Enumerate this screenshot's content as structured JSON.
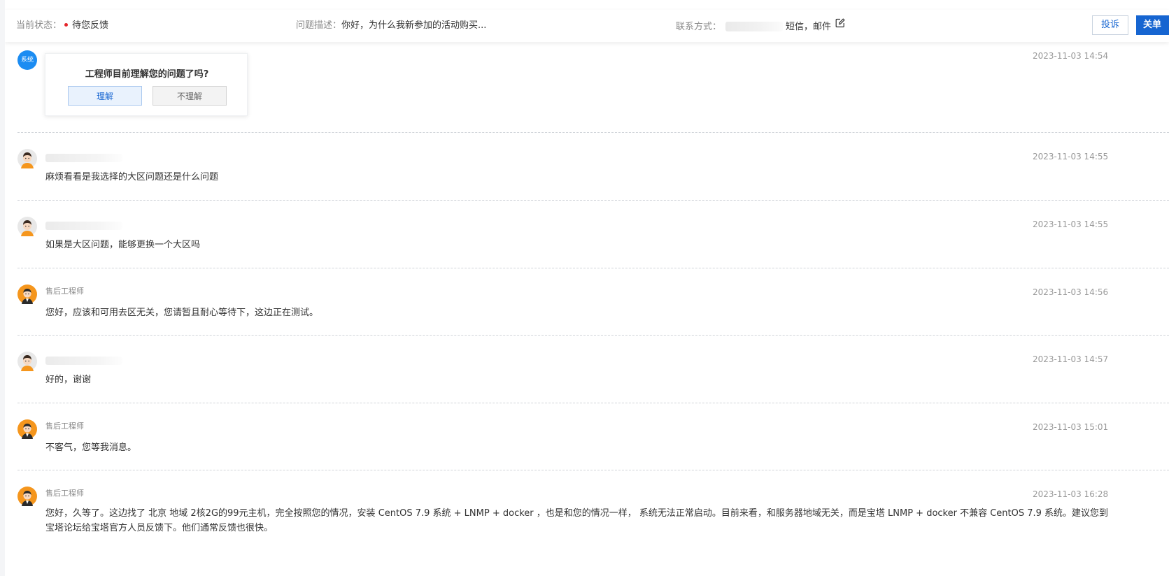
{
  "header": {
    "status_label": "当前状态：",
    "status_value": "待您反馈",
    "status_color": "#e5252a",
    "description_label": "问题描述：",
    "description_value": "你好，为什么我新参加的活动购买...",
    "contact_label": "联系方式：",
    "contact_methods": "短信，邮件",
    "edit_icon": "edit-icon",
    "complain_button": "投诉",
    "close_ticket_button": "关单"
  },
  "system_prompt": {
    "avatar_label": "系统",
    "question": "工程师目前理解您的问题了吗?",
    "understand_button": "理解",
    "not_understand_button": "不理解",
    "time": "2023-11-03 14:54"
  },
  "messages": [
    {
      "sender": "",
      "sender_type": "user",
      "text": "麻烦看看是我选择的大区问题还是什么问题",
      "time": "2023-11-03 14:55"
    },
    {
      "sender": "",
      "sender_type": "user",
      "text": "如果是大区问题，能够更换一个大区吗",
      "time": "2023-11-03 14:55"
    },
    {
      "sender": "售后工程师",
      "sender_type": "engineer",
      "text": "您好，应该和可用去区无关，您请暂且耐心等待下，这边正在测试。",
      "time": "2023-11-03 14:56"
    },
    {
      "sender": "",
      "sender_type": "user",
      "text": "好的，谢谢",
      "time": "2023-11-03 14:57"
    },
    {
      "sender": "售后工程师",
      "sender_type": "engineer",
      "text": "不客气，您等我消息。",
      "time": "2023-11-03 15:01"
    },
    {
      "sender": "售后工程师",
      "sender_type": "engineer",
      "text": "您好，久等了。这边找了 北京 地域 2核2G的99元主机，完全按照您的情况，安装 CentOS 7.9 系统 + LNMP + docker ，也是和您的情况一样， 系统无法正常启动。目前来看，和服务器地域无关，而是宝塔 LNMP + docker 不兼容 CentOS 7.9 系统。建议您到宝塔论坛给宝塔官方人员反馈下。他们通常反馈也很快。",
      "time": "2023-11-03 16:28"
    }
  ],
  "colors": {
    "accent": "#1665d1",
    "system_avatar": "#1b8cf2",
    "engineer_avatar": "#f5961d"
  }
}
